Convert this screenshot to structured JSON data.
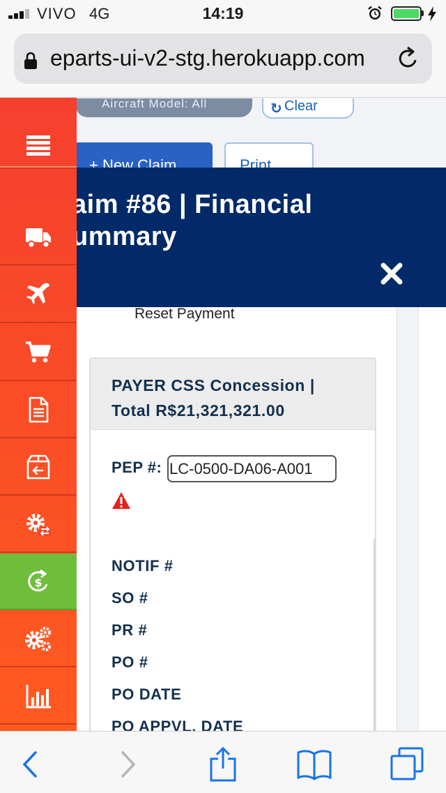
{
  "status_bar": {
    "carrier": "VIVO",
    "network": "4G",
    "time": "14:19",
    "battery_level": 1.0,
    "battery_color": "#4cd964"
  },
  "browser": {
    "url": "eparts-ui-v2-stg.herokuapp.com",
    "icons": [
      "lock-icon",
      "reload-icon"
    ]
  },
  "page": {
    "aircraft_filter": "Aircraft Model: All",
    "clear_label": "Clear",
    "new_claim_label": "+ New Claim",
    "print_label": "Print"
  },
  "sidebar": {
    "colors": {
      "base": "#f5402e",
      "active": "#6fbe3b"
    },
    "items": [
      {
        "name": "menu",
        "icon": "menu-icon"
      },
      {
        "name": "delivery",
        "icon": "truck-icon"
      },
      {
        "name": "aircraft",
        "icon": "airplane-icon"
      },
      {
        "name": "cart",
        "icon": "cart-icon"
      },
      {
        "name": "document",
        "icon": "document-icon"
      },
      {
        "name": "return",
        "icon": "return-box-icon"
      },
      {
        "name": "exchange",
        "icon": "gear-exchange-icon"
      },
      {
        "name": "financial",
        "icon": "money-refresh-icon",
        "active": true
      },
      {
        "name": "settings",
        "icon": "gears-icon"
      },
      {
        "name": "reports",
        "icon": "bar-chart-icon"
      }
    ]
  },
  "modal": {
    "title_line1": "aim #86 | Financial",
    "title_line2": "ummary",
    "header_color": "#032a68",
    "reset_payment": "Reset Payment",
    "card": {
      "header_line1": "PAYER CSS Concession |",
      "header_line2": "Total R$21,321,321.00",
      "pep_label": "PEP #:",
      "pep_value": "LC-0500-DA06-A001",
      "fields": [
        "NOTIF #",
        "SO #",
        "PR #",
        "PO #",
        "PO DATE",
        "PO APPVL. DATE"
      ]
    }
  },
  "toolbar": {
    "icons": [
      "back-icon",
      "forward-icon",
      "share-icon",
      "bookmarks-icon",
      "tabs-icon"
    ]
  }
}
